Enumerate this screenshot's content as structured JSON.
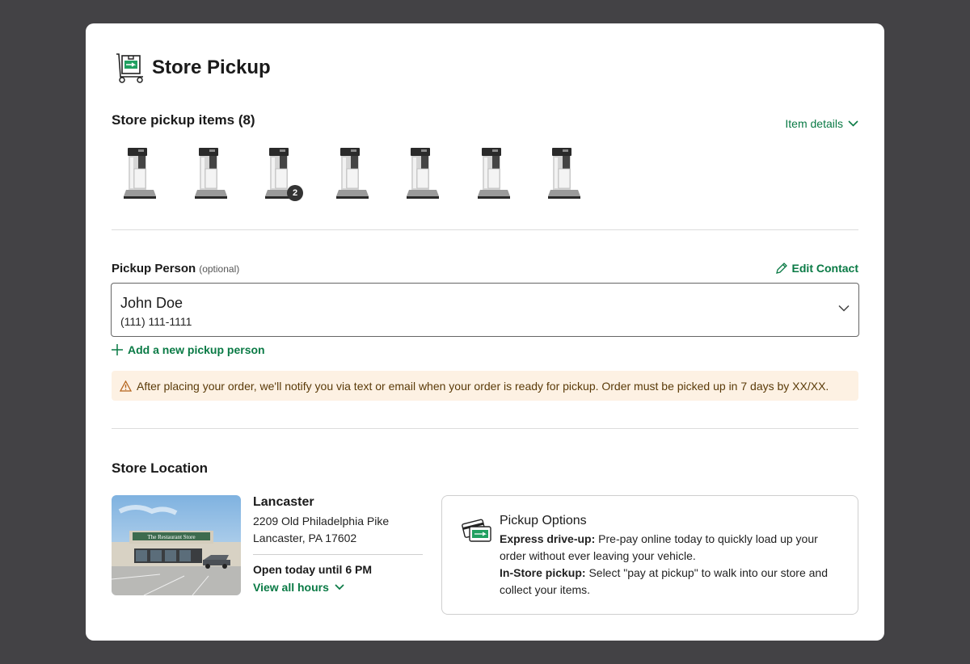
{
  "header": {
    "title": "Store Pickup",
    "icon": "cart-icon"
  },
  "items": {
    "title": "Store pickup items (8)",
    "details_label": "Item details",
    "thumbnails": [
      {
        "product": "coffee-brewer",
        "badge": ""
      },
      {
        "product": "coffee-brewer",
        "badge": ""
      },
      {
        "product": "coffee-brewer",
        "badge": "2"
      },
      {
        "product": "coffee-brewer",
        "badge": ""
      },
      {
        "product": "coffee-brewer",
        "badge": ""
      },
      {
        "product": "coffee-brewer",
        "badge": ""
      },
      {
        "product": "coffee-brewer",
        "badge": ""
      }
    ]
  },
  "pickup": {
    "label": "Pickup Person",
    "optional": "(optional)",
    "edit_label": "Edit Contact",
    "name": "John Doe",
    "phone": "(111) 111-1111",
    "add_label": "Add a new pickup person"
  },
  "notice": {
    "text": "After placing your order, we'll notify you via text or email when your order is ready for pickup. Order must be picked up in 7 days by XX/XX."
  },
  "location": {
    "title": "Store Location",
    "store_name": "Lancaster",
    "address_line1": "2209 Old Philadelphia Pike",
    "address_line2": "Lancaster, PA 17602",
    "hours": "Open today until 6 PM",
    "view_hours": "View all hours",
    "storefront_sign": "The Restaurant Store"
  },
  "options": {
    "title": "Pickup Options",
    "express_label": "Express drive-up:",
    "express_text": " Pre-pay online today to quickly load up your order without ever leaving your vehicle.",
    "instore_label": "In-Store pickup:",
    "instore_text": " Select \"pay at pickup\" to walk into our store and collect your items."
  },
  "colors": {
    "accent": "#0a7a45",
    "background": "#434245",
    "notice_bg": "#fdf1e3",
    "badge": "#333333"
  }
}
